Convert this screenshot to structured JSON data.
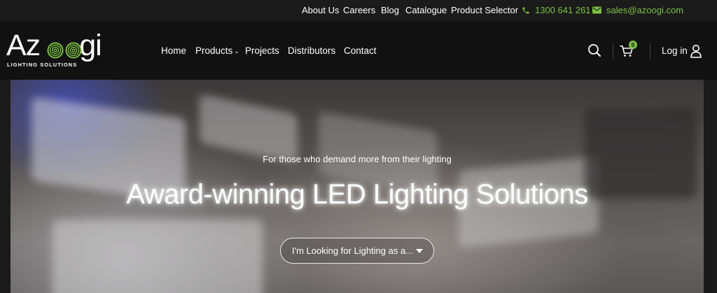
{
  "topbar": {
    "links": [
      "About Us",
      "Careers",
      "Blog",
      "Catalogue",
      "Product Selector"
    ],
    "phone": "1300 641 261",
    "email": "sales@azoogi.com",
    "accent": "#7ac143"
  },
  "logo": {
    "wordmark_start": "Az",
    "wordmark_end": "gi",
    "tagline": "LIGHTING SOLUTIONS"
  },
  "nav": {
    "items": [
      "Home",
      "Products",
      "Projects",
      "Distributors",
      "Contact"
    ]
  },
  "header": {
    "cart_count": "0",
    "login_label": "Log in",
    "icons": [
      "search-icon",
      "cart-icon",
      "user-icon"
    ]
  },
  "hero": {
    "eyebrow": "For those who demand more from their lighting",
    "headline": "Award-winning LED Lighting Solutions",
    "select_value": "I'm Looking for Lighting as a..."
  }
}
